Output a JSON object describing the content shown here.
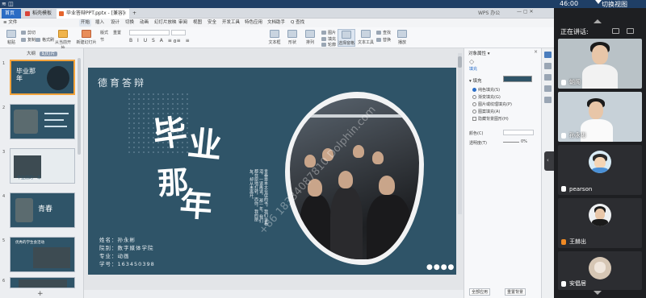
{
  "system": {
    "time": "46:00",
    "switch_view": "切换视图",
    "wifi": "≋ ◫"
  },
  "tabs": {
    "home": "首页",
    "docs": "稻壳模板",
    "file": "毕业答辩PPT.pptx - [兼容]",
    "right_hint": "WPS 办公",
    "close": "×",
    "add": "+"
  },
  "menu": {
    "items": [
      "≡ 文件",
      "开始",
      "插入",
      "设计",
      "切换",
      "动画",
      "幻灯片放映",
      "审阅",
      "视图",
      "安全",
      "开发工具",
      "特色应用",
      "文档助手",
      "Q 查找"
    ],
    "active_index": 1
  },
  "ribbon": {
    "paste": "粘贴",
    "cut": "剪切",
    "copy": "复制",
    "format_painter": "格式刷",
    "from_start": "从当前开始",
    "new_slide": "新建幻灯片",
    "layout": "版式",
    "section": "节",
    "reset": "重置",
    "font": "",
    "size": "0",
    "format_row": "B I U S A ≡ ≡ ≡",
    "textbox": "文本框",
    "shape": "形状",
    "arrange": "排列",
    "picture": "图片",
    "fill": "填充",
    "outline": "轮廓",
    "find": "查找",
    "replace": "替换",
    "select_pane": "选择窗格",
    "text_tools": "文本工具",
    "play": "播放"
  },
  "thumb_tabs": {
    "outline": "大纲",
    "slides": "幻灯片"
  },
  "thumb_numbers": [
    "1",
    "2",
    "3",
    "4",
    "5",
    "6"
  ],
  "thumb_texts": [
    "毕业那年",
    "",
    "毕业前的一年",
    "青春",
    "优秀的学生会活动",
    ""
  ],
  "add_slide": "+",
  "slide": {
    "category": "德育答辩",
    "char1": "毕",
    "char2": "业",
    "char3": "那",
    "char4": "年",
    "poem": "青春是本太仓促的书，我们含着泪，一读再读。 那一年，我们都在原地打转，而你，我的朋友，却从未离开。",
    "fields": [
      {
        "label": "姓名：",
        "value": "孙永彬"
      },
      {
        "label": "院别：",
        "value": "数字媒体学院"
      },
      {
        "label": "专业：",
        "value": "动画"
      },
      {
        "label": "学号：",
        "value": "163450398"
      }
    ],
    "pager": "●●●●",
    "watermark": "+86 18334087810 Dolphin.com"
  },
  "props": {
    "title": "对象属性 ▾",
    "close": "×",
    "fill_icon": "◇",
    "fill_tab": "填充",
    "section": "▾ 填充",
    "options": [
      "纯色填充(S)",
      "渐变填充(G)",
      "图片或纹理填充(P)",
      "图案填充(A)",
      "隐藏背景图形(H)"
    ],
    "selected_option": 0,
    "transparency_label": "颜色(C)",
    "transparency": "透明度(T)",
    "transparency_value": "0%",
    "apply_all": "全部应用",
    "reset_bg": "重置背景"
  },
  "meeting": {
    "header": "正在讲话:",
    "participants": [
      {
        "name": "朝阁",
        "type": "camera"
      },
      {
        "name": "孙永彬",
        "type": "camera"
      },
      {
        "name": "pearson",
        "type": "avatar"
      },
      {
        "name": "王赫出",
        "type": "avatar"
      },
      {
        "name": "安倡居",
        "type": "avatar"
      }
    ],
    "collapse": "‹"
  },
  "colors": {
    "slide_bg": "#2f5468",
    "accent_tab": "#2b6cc4",
    "selected_thumb": "#f3a33b",
    "meeting_bg": "#1e1f22"
  }
}
